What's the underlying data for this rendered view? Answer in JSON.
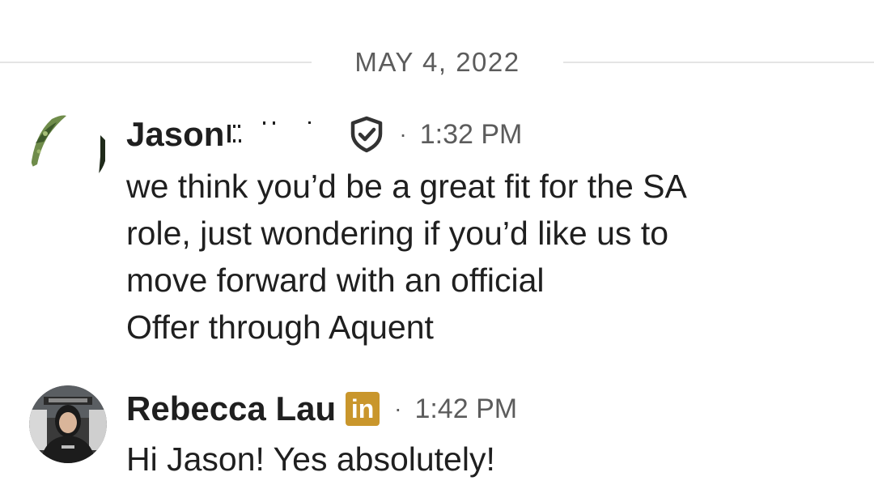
{
  "date_divider": {
    "label": "MAY 4, 2022"
  },
  "messages": [
    {
      "sender": "Jason",
      "sender_suffix": "I.:'",
      "badge": "shield-check-icon",
      "separator": "·",
      "time": "1:32 PM",
      "lines": [
        "we think you’d be a great fit for the SA",
        "role, just wondering if you’d like us to",
        "move forward with an official",
        "Offer through Aquent"
      ]
    },
    {
      "sender": "Rebecca Lau",
      "badge": "linkedin-icon",
      "badge_text": "in",
      "separator": "·",
      "time": "1:42 PM",
      "lines": [
        "Hi Jason! Yes absolutely!"
      ]
    }
  ],
  "colors": {
    "divider": "#e4e4e4",
    "muted_text": "#5c5c5c",
    "primary_text": "#1f1f1f",
    "linkedin_badge": "#c9962c"
  }
}
